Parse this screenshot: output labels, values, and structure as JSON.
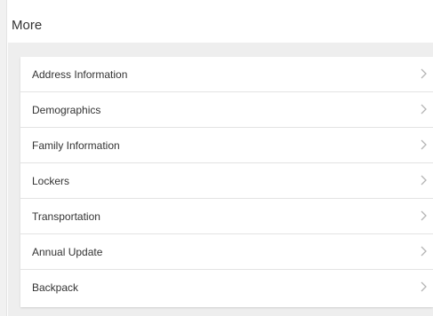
{
  "header": {
    "title": "More"
  },
  "menu": {
    "items": [
      {
        "label": "Address Information",
        "icon": "chevron-right-icon"
      },
      {
        "label": "Demographics",
        "icon": "chevron-right-icon"
      },
      {
        "label": "Family Information",
        "icon": "chevron-right-icon"
      },
      {
        "label": "Lockers",
        "icon": "chevron-right-icon"
      },
      {
        "label": "Transportation",
        "icon": "chevron-right-icon"
      },
      {
        "label": "Annual Update",
        "icon": "chevron-right-icon"
      },
      {
        "label": "Backpack",
        "icon": "chevron-right-icon"
      }
    ]
  },
  "colors": {
    "background_gray": "#eeeeee",
    "text": "#333333",
    "chevron": "#b5b5b5",
    "divider": "#e3e3e3"
  }
}
